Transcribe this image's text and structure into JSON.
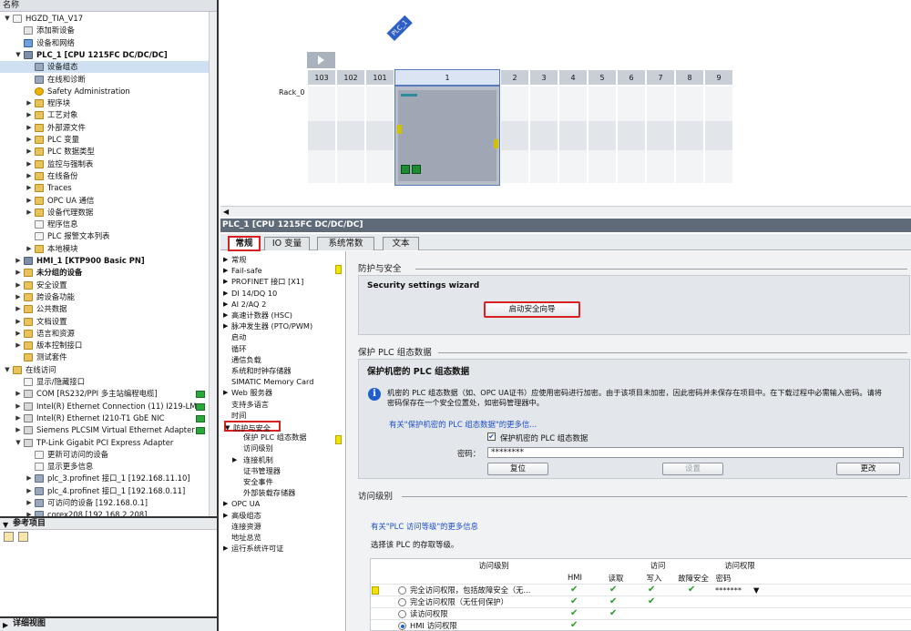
{
  "tree": {
    "header": "名称",
    "items": [
      {
        "label": "HGZD_TIA_V17",
        "indent": 0,
        "tw": "▼",
        "icon": "doc",
        "name": "project-root"
      },
      {
        "label": "添加新设备",
        "indent": 1,
        "tw": "",
        "icon": "add",
        "name": "add-new-device"
      },
      {
        "label": "设备和网络",
        "indent": 1,
        "tw": "",
        "icon": "net",
        "name": "devices-and-networks"
      },
      {
        "label": "PLC_1 [CPU 1215FC DC/DC/DC]",
        "indent": 1,
        "tw": "▼",
        "icon": "device",
        "bold": true,
        "name": "plc-1"
      },
      {
        "label": "设备组态",
        "indent": 2,
        "tw": "",
        "icon": "dev-small",
        "sel": true,
        "name": "device-configuration"
      },
      {
        "label": "在线和诊断",
        "indent": 2,
        "tw": "",
        "icon": "dev-small",
        "name": "online-diagnostics"
      },
      {
        "label": "Safety Administration",
        "indent": 2,
        "tw": "",
        "icon": "yellow-circle",
        "name": "safety-administration"
      },
      {
        "label": "程序块",
        "indent": 2,
        "tw": "▶",
        "icon": "folder",
        "name": "program-blocks"
      },
      {
        "label": "工艺对象",
        "indent": 2,
        "tw": "▶",
        "icon": "folder",
        "name": "technology-objects"
      },
      {
        "label": "外部源文件",
        "indent": 2,
        "tw": "▶",
        "icon": "folder",
        "name": "external-source-files"
      },
      {
        "label": "PLC 变量",
        "indent": 2,
        "tw": "▶",
        "icon": "folder",
        "name": "plc-tags"
      },
      {
        "label": "PLC 数据类型",
        "indent": 2,
        "tw": "▶",
        "icon": "folder",
        "name": "plc-data-types"
      },
      {
        "label": "监控与强制表",
        "indent": 2,
        "tw": "▶",
        "icon": "folder",
        "name": "watch-force-tables"
      },
      {
        "label": "在线备份",
        "indent": 2,
        "tw": "▶",
        "icon": "folder",
        "name": "online-backups"
      },
      {
        "label": "Traces",
        "indent": 2,
        "tw": "▶",
        "icon": "folder",
        "name": "traces"
      },
      {
        "label": "OPC UA 通信",
        "indent": 2,
        "tw": "▶",
        "icon": "folder",
        "name": "opc-ua-communication"
      },
      {
        "label": "设备代理数据",
        "indent": 2,
        "tw": "▶",
        "icon": "folder",
        "name": "device-proxy-data"
      },
      {
        "label": "程序信息",
        "indent": 2,
        "tw": "",
        "icon": "doc",
        "name": "program-info"
      },
      {
        "label": "PLC 报警文本列表",
        "indent": 2,
        "tw": "",
        "icon": "doc",
        "name": "plc-alarm-text-lists"
      },
      {
        "label": "本地模块",
        "indent": 2,
        "tw": "▶",
        "icon": "folder",
        "name": "local-modules"
      },
      {
        "label": "HMI_1 [KTP900 Basic PN]",
        "indent": 1,
        "tw": "▶",
        "icon": "device",
        "bold": true,
        "name": "hmi-1"
      },
      {
        "label": "未分组的设备",
        "indent": 1,
        "tw": "▶",
        "icon": "folder",
        "bold": true,
        "name": "ungrouped-devices"
      },
      {
        "label": "安全设置",
        "indent": 1,
        "tw": "▶",
        "icon": "folder",
        "name": "security-settings"
      },
      {
        "label": "跨设备功能",
        "indent": 1,
        "tw": "▶",
        "icon": "folder",
        "name": "cross-device-functions"
      },
      {
        "label": "公共数据",
        "indent": 1,
        "tw": "▶",
        "icon": "folder",
        "name": "common-data"
      },
      {
        "label": "文档设置",
        "indent": 1,
        "tw": "▶",
        "icon": "folder",
        "name": "documentation-settings"
      },
      {
        "label": "语言和资源",
        "indent": 1,
        "tw": "▶",
        "icon": "folder",
        "name": "languages-resources"
      },
      {
        "label": "版本控制接口",
        "indent": 1,
        "tw": "▶",
        "icon": "folder",
        "name": "version-control-interface"
      },
      {
        "label": "测试套件",
        "indent": 1,
        "tw": "",
        "icon": "folder",
        "name": "test-suite"
      },
      {
        "label": "在线访问",
        "indent": 0,
        "tw": "▼",
        "icon": "folder",
        "name": "online-access"
      },
      {
        "label": "显示/隐藏接口",
        "indent": 1,
        "tw": "",
        "icon": "doc",
        "name": "show-hide-interfaces"
      },
      {
        "label": "COM [RS232/PPI 多主站编程电缆]",
        "indent": 1,
        "tw": "▶",
        "icon": "nic",
        "green": true,
        "name": "com-rs232-ppi"
      },
      {
        "label": "Intel(R) Ethernet Connection (11) I219-LM",
        "indent": 1,
        "tw": "▶",
        "icon": "nic",
        "green": true,
        "name": "intel-i219-lm"
      },
      {
        "label": "Intel(R) Ethernet I210-T1 GbE NIC",
        "indent": 1,
        "tw": "▶",
        "icon": "nic",
        "green": true,
        "name": "intel-i210-t1"
      },
      {
        "label": "Siemens PLCSIM Virtual Ethernet Adapter",
        "indent": 1,
        "tw": "▶",
        "icon": "nic",
        "green": true,
        "name": "plcsim-virtual-adapter"
      },
      {
        "label": "TP-Link Gigabit PCI Express Adapter",
        "indent": 1,
        "tw": "▼",
        "icon": "nic",
        "name": "tp-link-adapter"
      },
      {
        "label": "更新可访问的设备",
        "indent": 2,
        "tw": "",
        "icon": "doc",
        "name": "update-accessible-devices"
      },
      {
        "label": "显示更多信息",
        "indent": 2,
        "tw": "",
        "icon": "doc",
        "name": "show-more-info"
      },
      {
        "label": "plc_3.profinet 接口_1 [192.168.11.10]",
        "indent": 2,
        "tw": "▶",
        "icon": "dev-small",
        "name": "plc-3-profinet"
      },
      {
        "label": "plc_4.profinet 接口_1 [192.168.0.11]",
        "indent": 2,
        "tw": "▶",
        "icon": "dev-small",
        "name": "plc-4-profinet"
      },
      {
        "label": "可访问的设备 [192.168.0.1]",
        "indent": 2,
        "tw": "▶",
        "icon": "dev-small",
        "name": "accessible-device-192-168-0-1"
      },
      {
        "label": "corex208 [192.168.2.208]",
        "indent": 2,
        "tw": "▶",
        "icon": "dev-small",
        "name": "corex208"
      }
    ]
  },
  "reference": {
    "title": "参考项目"
  },
  "detail": {
    "title": "详细视图"
  },
  "device_view": {
    "plc_tag": "PLC_1",
    "rack_label": "Rack_0",
    "slots": [
      "103",
      "102",
      "101",
      "1",
      "2",
      "3",
      "4",
      "5",
      "6",
      "7",
      "8",
      "9"
    ]
  },
  "properties": {
    "title": "PLC_1 [CPU 1215FC DC/DC/DC]",
    "tabs": [
      "常规",
      "IO 变量",
      "系统常数",
      "文本"
    ],
    "nav": [
      {
        "label": "常规",
        "indent": 0,
        "tw": "▶"
      },
      {
        "label": "Fail-safe",
        "indent": 0,
        "tw": "▶"
      },
      {
        "label": "PROFINET 接口 [X1]",
        "indent": 0,
        "tw": "▶"
      },
      {
        "label": "DI 14/DQ 10",
        "indent": 0,
        "tw": "▶"
      },
      {
        "label": "AI 2/AQ 2",
        "indent": 0,
        "tw": "▶"
      },
      {
        "label": "高速计数器 (HSC)",
        "indent": 0,
        "tw": "▶"
      },
      {
        "label": "脉冲发生器 (PTO/PWM)",
        "indent": 0,
        "tw": "▶"
      },
      {
        "label": "启动",
        "indent": 0,
        "tw": ""
      },
      {
        "label": "循环",
        "indent": 0,
        "tw": ""
      },
      {
        "label": "通信负载",
        "indent": 0,
        "tw": ""
      },
      {
        "label": "系统和时钟存储器",
        "indent": 0,
        "tw": ""
      },
      {
        "label": "SIMATIC Memory Card",
        "indent": 0,
        "tw": ""
      },
      {
        "label": "Web 服务器",
        "indent": 0,
        "tw": "▶"
      },
      {
        "label": "支持多语言",
        "indent": 0,
        "tw": ""
      },
      {
        "label": "时间",
        "indent": 0,
        "tw": ""
      },
      {
        "label": "防护与安全",
        "indent": 0,
        "tw": "▼",
        "sel": true
      },
      {
        "label": "保护 PLC 组态数据",
        "indent": 1,
        "tw": ""
      },
      {
        "label": "访问级别",
        "indent": 1,
        "tw": ""
      },
      {
        "label": "连接机制",
        "indent": 1,
        "tw": "▶"
      },
      {
        "label": "证书管理器",
        "indent": 1,
        "tw": ""
      },
      {
        "label": "安全事件",
        "indent": 1,
        "tw": ""
      },
      {
        "label": "外部装载存储器",
        "indent": 1,
        "tw": ""
      },
      {
        "label": "OPC UA",
        "indent": 0,
        "tw": "▶"
      },
      {
        "label": "高级组态",
        "indent": 0,
        "tw": "▶"
      },
      {
        "label": "连接资源",
        "indent": 0,
        "tw": ""
      },
      {
        "label": "地址总览",
        "indent": 0,
        "tw": ""
      },
      {
        "label": "运行系统许可证",
        "indent": 0,
        "tw": "▶"
      }
    ],
    "protection": {
      "title": "防护与安全",
      "wizard_heading": "Security settings wizard",
      "wizard_button": "启动安全向导"
    },
    "protect_config": {
      "title": "保护 PLC 组态数据",
      "panel_heading": "保护机密的 PLC 组态数据",
      "info_text_1": "机密的 PLC 组态数据（如、OPC UA证书）应使用密码进行加密。由于该项目未加密，因此密码并未保存在项目中。在下载过程中必需输入密码。请将",
      "info_text_2": "密码保存在一个安全位置处，如密码管理器中。",
      "link": "有关\"保护机密的 PLC 组态数据\"的更多信...",
      "checkbox_label": "保护机密的 PLC 组态数据",
      "password_label": "密码：",
      "password_value": "********",
      "reset_button": "复位",
      "set_button": "设置",
      "change_button": "更改"
    },
    "access_level": {
      "title": "访问级别",
      "link": "有关\"PLC 访问等级\"的更多信息",
      "prompt": "选择该 PLC 的存取等级。",
      "headers": {
        "level": "访问级别",
        "access": "访问",
        "permission": "访问权限",
        "hmi": "HMI",
        "read": "读取",
        "write": "写入",
        "failsafe": "故障安全",
        "password": "密码"
      },
      "rows": [
        {
          "label": "完全访问权限，包括故障安全（无...",
          "hmi": "✔",
          "read": "✔",
          "write": "✔",
          "failsafe": "✔",
          "password": "*******",
          "checked": false,
          "yellow": true
        },
        {
          "label": "完全访问权限（无任何保护）",
          "hmi": "✔",
          "read": "✔",
          "write": "✔",
          "failsafe": "",
          "password": "",
          "checked": false,
          "yellow": false
        },
        {
          "label": "读访问权限",
          "hmi": "✔",
          "read": "✔",
          "write": "",
          "failsafe": "",
          "password": "",
          "checked": false,
          "yellow": false
        },
        {
          "label": "HMI 访问权限",
          "hmi": "✔",
          "read": "",
          "write": "",
          "failsafe": "",
          "password": "",
          "checked": true,
          "yellow": false
        }
      ]
    }
  }
}
